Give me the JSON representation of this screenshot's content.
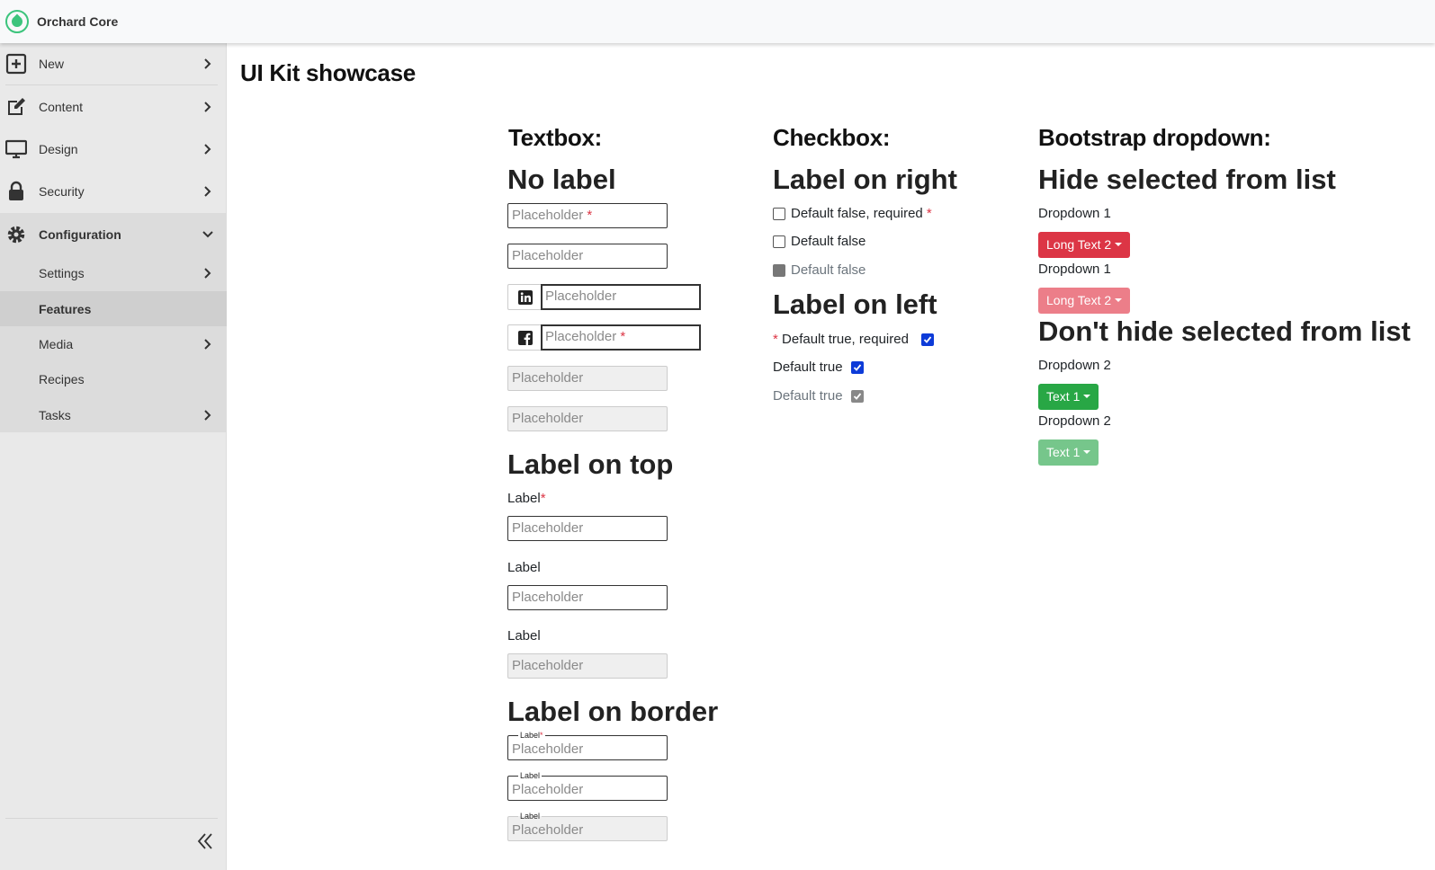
{
  "app": {
    "title": "Orchard Core"
  },
  "sidebar": {
    "items": [
      {
        "label": "New",
        "icon": "plus-square-icon"
      },
      {
        "label": "Content",
        "icon": "edit-icon"
      },
      {
        "label": "Design",
        "icon": "monitor-icon"
      },
      {
        "label": "Security",
        "icon": "lock-icon"
      },
      {
        "label": "Configuration",
        "icon": "gear-icon",
        "expanded": true
      }
    ],
    "subitems": [
      {
        "label": "Settings",
        "has_children": true
      },
      {
        "label": "Features",
        "active": true
      },
      {
        "label": "Media",
        "has_children": true
      },
      {
        "label": "Recipes"
      },
      {
        "label": "Tasks",
        "has_children": true
      }
    ],
    "collapse_icon": "double-chevron-left-icon"
  },
  "page": {
    "title": "UI Kit showcase"
  },
  "textbox": {
    "heading": "Textbox:",
    "no_label": {
      "heading": "No label",
      "placeholder": "Placeholder",
      "required_mark": "*",
      "linkedin_icon": "linkedin-icon",
      "facebook_icon": "facebook-icon"
    },
    "label_on_top": {
      "heading": "Label on top",
      "label": "Label",
      "required_mark": "*",
      "placeholder": "Placeholder"
    },
    "label_on_border": {
      "heading": "Label on border",
      "label": "Label",
      "required_mark": "*",
      "placeholder": "Placeholder"
    }
  },
  "checkbox": {
    "heading": "Checkbox:",
    "label_on_right": {
      "heading": "Label on right",
      "items": [
        {
          "label": "Default false, required",
          "checked": false,
          "required": true
        },
        {
          "label": "Default false",
          "checked": false
        },
        {
          "label": "Default false",
          "checked": false,
          "disabled": true
        }
      ]
    },
    "label_on_left": {
      "heading": "Label on left",
      "items": [
        {
          "label": "Default true, required",
          "checked": true,
          "required": true
        },
        {
          "label": "Default true",
          "checked": true
        },
        {
          "label": "Default true",
          "checked": true,
          "disabled": true
        }
      ]
    },
    "required_mark": "*"
  },
  "dropdown": {
    "heading": "Bootstrap dropdown:",
    "hide_selected": {
      "heading": "Hide selected from list",
      "label": "Dropdown 1",
      "value": "Long Text 2",
      "color": "#dc3545",
      "disabled_color": "#ec7e89"
    },
    "dont_hide_selected": {
      "heading": "Don't hide selected from list",
      "label": "Dropdown 2",
      "value": "Text 1",
      "color": "#28a745",
      "disabled_color": "#76c68b"
    }
  }
}
